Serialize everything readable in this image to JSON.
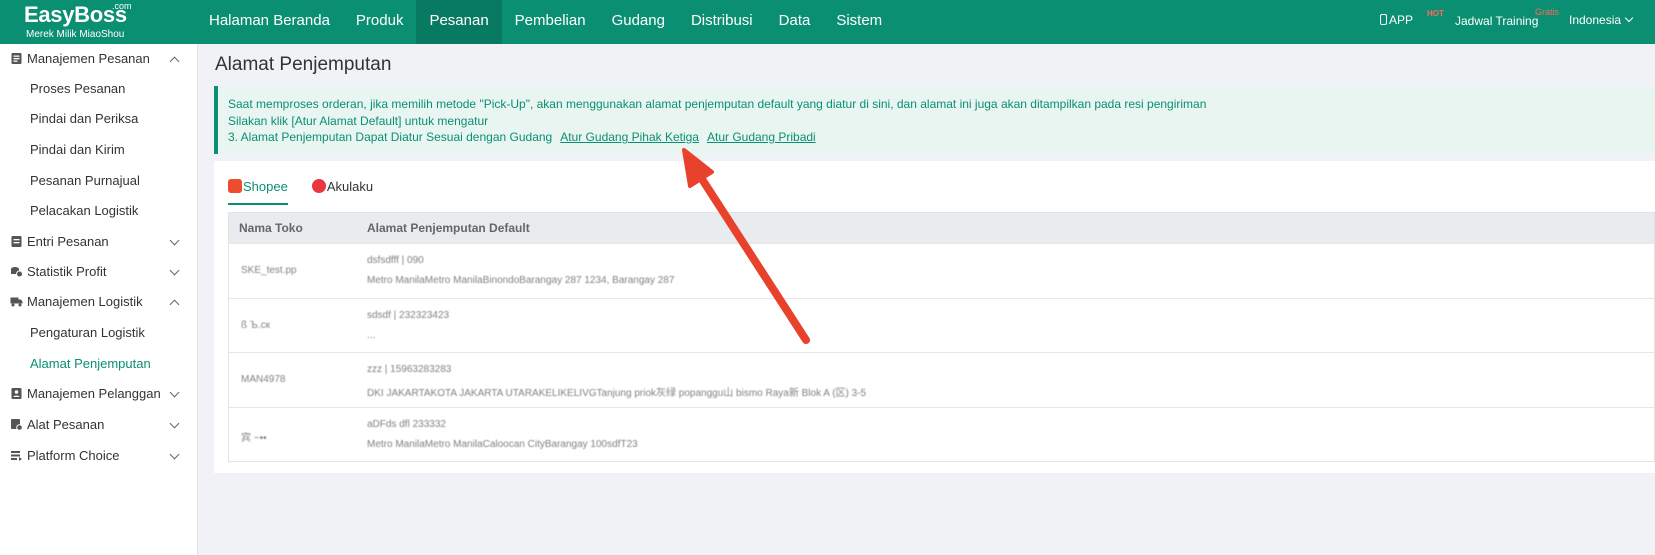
{
  "logo": {
    "main": "EasyBoss",
    "com": ".com",
    "sub": "Merek Milik MiaoShou"
  },
  "nav": [
    {
      "label": "Halaman Beranda",
      "active": false
    },
    {
      "label": "Produk",
      "active": false
    },
    {
      "label": "Pesanan",
      "active": true
    },
    {
      "label": "Pembelian",
      "active": false
    },
    {
      "label": "Gudang",
      "active": false
    },
    {
      "label": "Distribusi",
      "active": false
    },
    {
      "label": "Data",
      "active": false
    },
    {
      "label": "Sistem",
      "active": false
    }
  ],
  "topright": {
    "app": "APP",
    "hot": "HOT",
    "training": "Jadwal Training",
    "gratis": "Gratis",
    "lang": "Indonesia"
  },
  "sidebar": {
    "g_order_mgmt": "Manajemen Pesanan",
    "proses": "Proses Pesanan",
    "pindai_periksa": "Pindai dan Periksa",
    "pindai_kirim": "Pindai dan Kirim",
    "purnajual": "Pesanan Purnajual",
    "pelacakan": "Pelacakan Logistik",
    "g_entri": "Entri Pesanan",
    "g_statistik": "Statistik Profit",
    "g_logistik": "Manajemen Logistik",
    "pengaturan": "Pengaturan Logistik",
    "alamat": "Alamat Penjemputan",
    "g_pelanggan": "Manajemen Pelanggan",
    "g_alat": "Alat Pesanan",
    "g_platform": "Platform Choice"
  },
  "page": {
    "title": "Alamat Penjemputan"
  },
  "notice": {
    "line1": "Saat memproses orderan, jika memilih metode \"Pick-Up\", akan menggunakan alamat penjemputan default yang diatur di sini, dan alamat ini juga akan ditampilkan pada resi pengiriman",
    "line2": "Silakan klik [Atur Alamat Default] untuk mengatur",
    "line3": "3. Alamat Penjemputan Dapat Diatur Sesuai dengan Gudang",
    "link1": "Atur Gudang Pihak Ketiga",
    "link2": "Atur Gudang Pribadi"
  },
  "tabs": [
    {
      "label": "Shopee",
      "active": true,
      "color": "#ee4d2d"
    },
    {
      "label": "Akulaku",
      "active": false,
      "color": "#e8383d"
    }
  ],
  "table": {
    "headers": [
      "Nama Toko",
      "Alamat Penjemputan Default"
    ],
    "rows": [
      {
        "shop": "SKE_test.pp",
        "l1": "dsfsdfff | 090",
        "l2": "Metro ManilaMetro ManilaBinondoBarangay 287 1234, Barangay 287"
      },
      {
        "shop": "ß  Ъ.ск",
        "l1": "sdsdf | 232323423",
        "l2": "  ..."
      },
      {
        "shop": "MAN4978",
        "l1": "zzz | 15963283283",
        "l2": "DKI JAKARTAKOTA JAKARTA UTARAKELIKELIVGTanjung priok灰绿 popanggu山 bismo Raya新 Blok A (区) 3-5"
      },
      {
        "shop": "宾  ~••",
        "l1": "aDFds dfl 233332",
        "l2": "Metro ManilaMetro ManilaCaloocan CityBarangay 100sdfT23"
      }
    ]
  },
  "colors": {
    "brand": "#0b8f73",
    "arrow": "#e8412c"
  }
}
